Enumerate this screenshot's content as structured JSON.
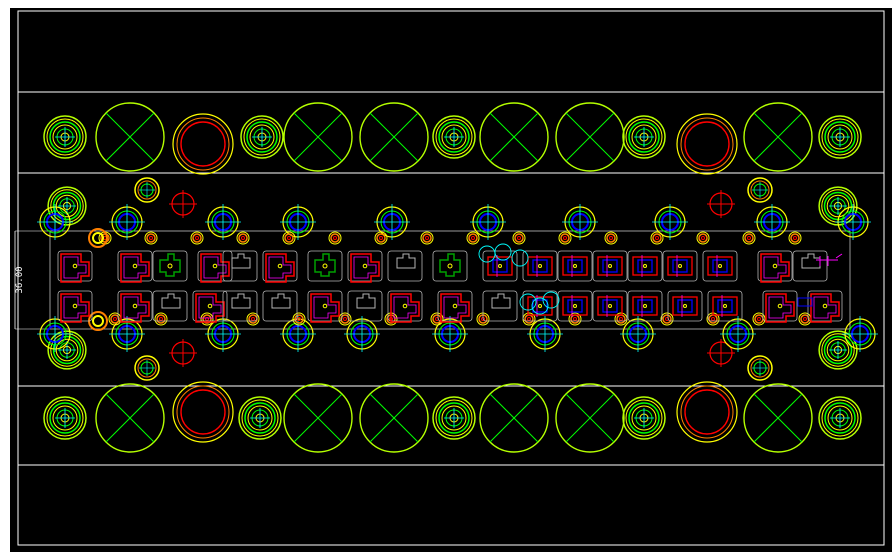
{
  "drawing": {
    "dimension_label": "36.00"
  },
  "colors": {
    "background": "#000000",
    "border": "#ffffff",
    "strip_lines": "#ffffff",
    "green": "#00ff00",
    "yellow": "#ffff00",
    "yellow_green": "#b4ff00",
    "red": "#ff0000",
    "orange": "#ff8000",
    "cyan": "#00ffff",
    "blue": "#0000ff",
    "magenta": "#ff00ff",
    "grey": "#b4b4b4",
    "dark_green": "#00a000"
  },
  "icons": {
    "big_cross_circle": "large-cross-circle-icon",
    "concentric_circle": "concentric-circle-icon",
    "red_ring": "red-ring-icon",
    "pilot_hole": "pilot-hole-icon",
    "red_crosshair": "red-crosshair-icon"
  }
}
